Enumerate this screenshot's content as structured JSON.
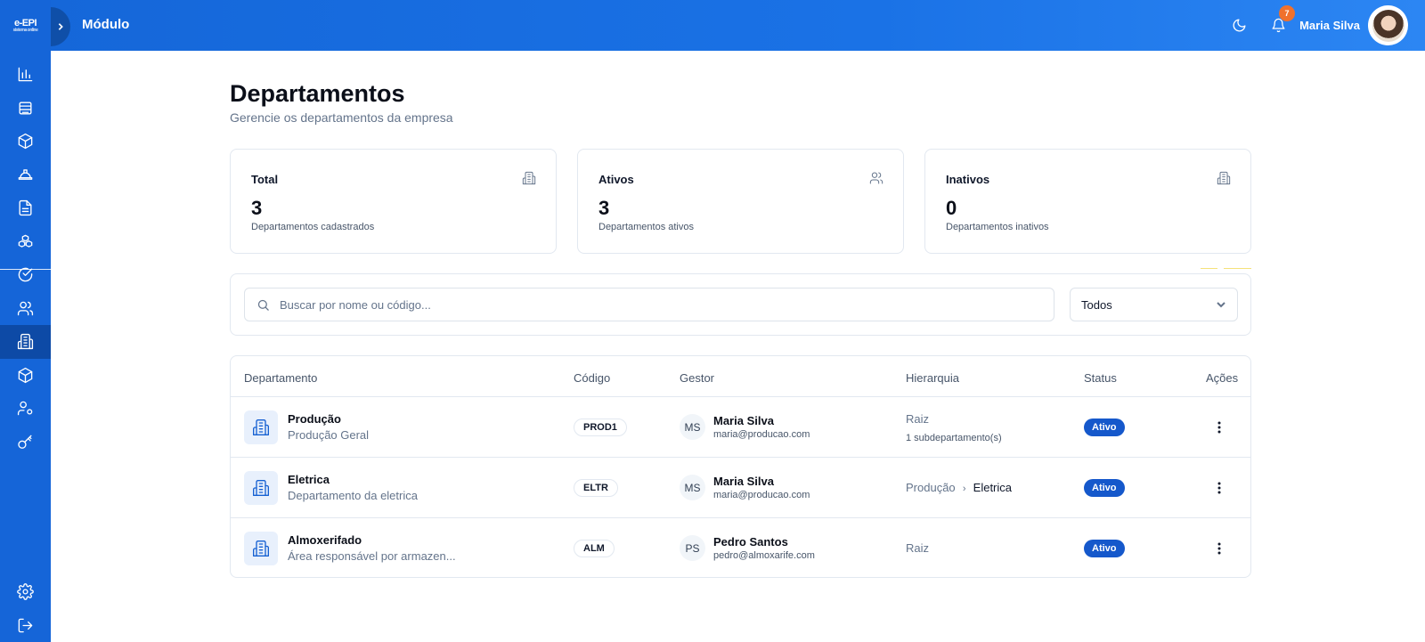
{
  "app": {
    "logo_text": "e-EPI",
    "logo_subtext": "sistema online",
    "header_title": "Módulo"
  },
  "header": {
    "notification_count": "7",
    "user_name": "Maria Silva"
  },
  "sidebar": {
    "items": [
      {
        "icon": "bar-chart-icon"
      },
      {
        "icon": "database-icon"
      },
      {
        "icon": "box-icon"
      },
      {
        "icon": "hard-hat-icon"
      },
      {
        "icon": "file-text-icon"
      },
      {
        "icon": "boxes-icon"
      },
      {
        "icon": "check-circle-icon"
      },
      {
        "icon": "users-icon"
      },
      {
        "icon": "building-icon",
        "active": true
      },
      {
        "icon": "package-icon"
      },
      {
        "icon": "user-cog-icon"
      },
      {
        "icon": "key-icon"
      }
    ],
    "bottom_items": [
      {
        "icon": "settings-icon"
      },
      {
        "icon": "logout-icon"
      }
    ]
  },
  "page": {
    "title": "Departamentos",
    "subtitle": "Gerencie os departamentos da empresa"
  },
  "stats": [
    {
      "label": "Total",
      "value": "3",
      "description": "Departamentos cadastrados",
      "icon": "building-icon"
    },
    {
      "label": "Ativos",
      "value": "3",
      "description": "Departamentos ativos",
      "icon": "users-icon"
    },
    {
      "label": "Inativos",
      "value": "0",
      "description": "Departamentos inativos",
      "icon": "building-icon"
    }
  ],
  "filters": {
    "search_placeholder": "Buscar por nome ou código...",
    "status_selected": "Todos"
  },
  "table": {
    "headers": [
      "Departamento",
      "Código",
      "Gestor",
      "Hierarquia",
      "Status",
      "Ações"
    ],
    "rows": [
      {
        "name": "Produção",
        "description": "Produção Geral",
        "code": "PROD1",
        "manager_initials": "MS",
        "manager_name": "Maria Silva",
        "manager_email": "maria@producao.com",
        "hierarchy": "Raiz",
        "hierarchy_sub": "1 subdepartamento(s)",
        "status": "Ativo"
      },
      {
        "name": "Eletrica",
        "description": "Departamento da eletrica",
        "code": "ELTR",
        "manager_initials": "MS",
        "manager_name": "Maria Silva",
        "manager_email": "maria@producao.com",
        "hierarchy_parent": "Produção",
        "hierarchy_current": "Eletrica",
        "status": "Ativo"
      },
      {
        "name": "Almoxerifado",
        "description": "Área responsável por armazen...",
        "code": "ALM",
        "manager_initials": "PS",
        "manager_name": "Pedro Santos",
        "manager_email": "pedro@almoxarife.com",
        "hierarchy": "Raiz",
        "status": "Ativo"
      }
    ]
  },
  "colors": {
    "primary": "#1565d8",
    "sidebar_active": "#0d4aa6",
    "badge": "#f0712c",
    "status_active": "#1558cb"
  }
}
